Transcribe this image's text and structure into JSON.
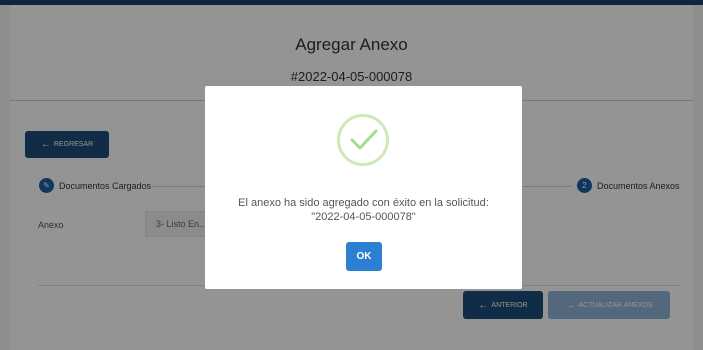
{
  "page": {
    "title": "Agregar Anexo",
    "request_id": "#2022-04-05-000078"
  },
  "back_button": {
    "label": "Regresar"
  },
  "steps": [
    {
      "number": "",
      "label": "Documentos Cargados"
    },
    {
      "number": "2",
      "label": "Documentos Anexos"
    }
  ],
  "form": {
    "annex_label": "Anexo",
    "annex_value": "3- Listo En..."
  },
  "footer": {
    "previous_label": "Anterior",
    "update_label": "Actualizar Anexos"
  },
  "modal": {
    "message_line1": "El anexo ha sido agregado con éxito en la solicitud:",
    "message_line2": "\"2022-04-05-000078\"",
    "ok_label": "OK",
    "success_color": "#a5dc86"
  },
  "colors": {
    "primary": "#1d4d7a",
    "accent": "#2c7fd1"
  }
}
